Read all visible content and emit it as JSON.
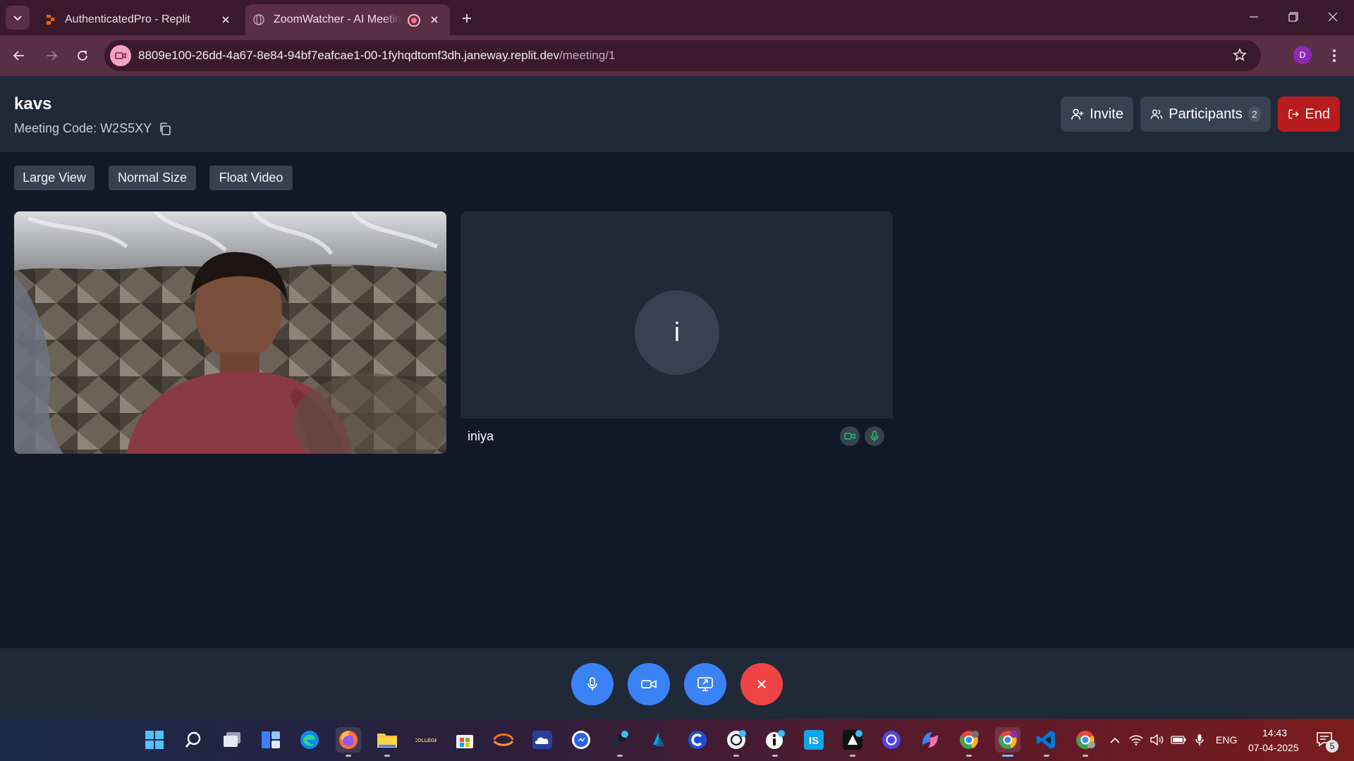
{
  "browser": {
    "tabs": [
      {
        "title": "AuthenticatedPro - Replit",
        "active": false
      },
      {
        "title": "ZoomWatcher - AI Meeting",
        "active": true
      }
    ],
    "url_host": "8809e100-26dd-4a67-8e84-94bf7eafcae1-00-1fyhqdtomf3dh.janeway.replit.dev",
    "url_path": "/meeting/1",
    "profile_initial": "D",
    "accent": "#5a2f44"
  },
  "meeting": {
    "title": "kavs",
    "code_label": "Meeting Code: W2S5XY",
    "buttons": {
      "invite": "Invite",
      "participants": "Participants",
      "participants_count": "2",
      "end": "End"
    },
    "view_options": [
      "Large View",
      "Normal Size",
      "Float Video"
    ]
  },
  "participants": [
    {
      "name": "",
      "camera": "on"
    },
    {
      "name": "iniya",
      "initial": "i",
      "camera": "on",
      "mic": "on"
    }
  ],
  "controls": [
    {
      "icon": "mic-icon",
      "color": "#3b82f6"
    },
    {
      "icon": "video-camera-icon",
      "color": "#3b82f6"
    },
    {
      "icon": "screen-share-icon",
      "color": "#3b82f6"
    },
    {
      "icon": "close-icon",
      "color": "#ef4444"
    }
  ],
  "taskbar": {
    "pinned": [
      "start-icon",
      "search-icon",
      "task-view-icon",
      "widgets-icon",
      "edge-icon",
      "firefox-icon",
      "file-explorer-icon",
      "college-app-icon",
      "microsoft-store-icon",
      "arc-app-icon",
      "cloud-app-icon",
      "messenger-icon",
      "docker-app-icon",
      "azure-icon",
      "c-app-icon",
      "chatgpt-icon",
      "info-app-icon",
      "is-app-icon",
      "capcut-icon",
      "openai-icon",
      "copilot-icon",
      "chrome-profile-e-icon",
      "chrome-profile-d-icon",
      "vscode-icon",
      "chrome-icon"
    ],
    "language": "ENG",
    "time": "14:43",
    "date": "07-04-2025",
    "notifications": "5"
  }
}
